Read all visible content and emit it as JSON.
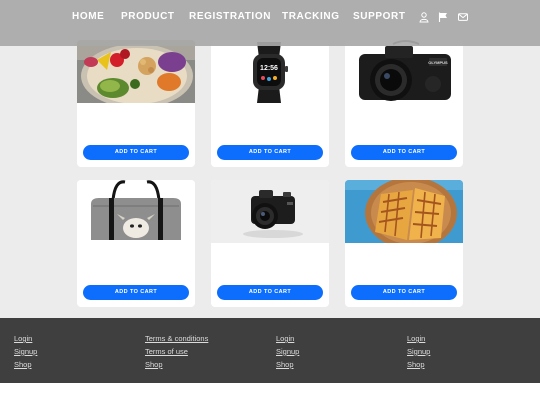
{
  "nav": {
    "items": [
      "HOME",
      "PRODUCT",
      "REGISTRATION",
      "TRACKING",
      "SUPPORT"
    ],
    "icons": [
      "user-icon",
      "flag-icon",
      "mail-icon"
    ]
  },
  "products": [
    {
      "image": "salad-bowl-image",
      "button": "ADD TO CART"
    },
    {
      "image": "smartwatch-image",
      "button": "ADD TO CART"
    },
    {
      "image": "dslr-camera-image",
      "button": "ADD TO CART"
    },
    {
      "image": "handbag-image",
      "button": "ADD TO CART"
    },
    {
      "image": "compact-camera-image",
      "button": "ADD TO CART"
    },
    {
      "image": "grilled-sandwich-image",
      "button": "ADD TO CART"
    }
  ],
  "footer": {
    "columns": [
      [
        "Login",
        "Signup",
        "Shop"
      ],
      [
        "Terms & conditions",
        "Terms of use",
        "Shop"
      ],
      [
        "Login",
        "Signup",
        "Shop"
      ],
      [
        "Login",
        "Signup",
        "Shop"
      ]
    ]
  },
  "colors": {
    "accent": "#0d6efd",
    "navbar": "#a8a8a8",
    "page_bg": "#ececec",
    "footer_bg": "#3f3f3f"
  }
}
